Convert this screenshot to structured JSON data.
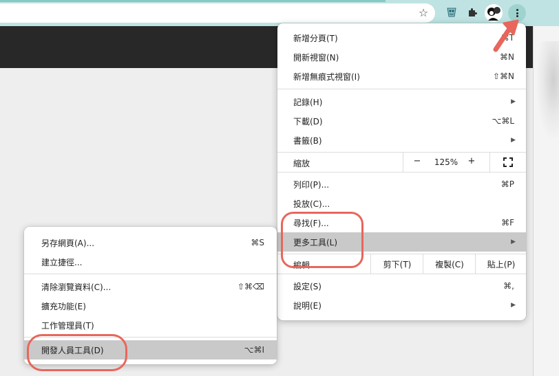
{
  "colors": {
    "accent": "#e8665b",
    "toolbar": "#bfe3e2",
    "highlight": "#c9c9c9",
    "dark_bar": "#282828"
  },
  "toolbar": {
    "bookmark_icon": "star-icon",
    "extension_icon": "extension-icon",
    "extensions_icon": "puzzle-icon",
    "menu_icon": "kebab-menu-icon"
  },
  "main_menu": {
    "new_tab": {
      "label": "新增分頁(T)",
      "shortcut": "⌘T"
    },
    "new_window": {
      "label": "開新視窗(N)",
      "shortcut": "⌘N"
    },
    "incognito": {
      "label": "新增無痕式視窗(I)",
      "shortcut": "⇧⌘N"
    },
    "history": {
      "label": "記錄(H)"
    },
    "downloads": {
      "label": "下載(D)",
      "shortcut": "⌥⌘L"
    },
    "bookmarks": {
      "label": "書籤(B)"
    },
    "zoom": {
      "label": "縮放",
      "minus": "−",
      "value": "125%",
      "plus": "+"
    },
    "print": {
      "label": "列印(P)...",
      "shortcut": "⌘P"
    },
    "cast": {
      "label": "投放(C)..."
    },
    "find": {
      "label": "尋找(F)...",
      "shortcut": "⌘F"
    },
    "more_tools": {
      "label": "更多工具(L)"
    },
    "edit": {
      "label": "編輯",
      "cut": "剪下(T)",
      "copy": "複製(C)",
      "paste": "貼上(P)"
    },
    "settings": {
      "label": "設定(S)",
      "shortcut": "⌘,"
    },
    "help": {
      "label": "說明(E)"
    }
  },
  "sub_menu": {
    "save_page": {
      "label": "另存網頁(A)...",
      "shortcut": "⌘S"
    },
    "create_shortcut": {
      "label": "建立捷徑..."
    },
    "clear_data": {
      "label": "清除瀏覽資料(C)...",
      "shortcut": "⇧⌘⌫"
    },
    "extensions": {
      "label": "擴充功能(E)"
    },
    "task_manager": {
      "label": "工作管理員(T)"
    },
    "dev_tools": {
      "label": "開發人員工具(D)",
      "shortcut": "⌥⌘I"
    }
  }
}
